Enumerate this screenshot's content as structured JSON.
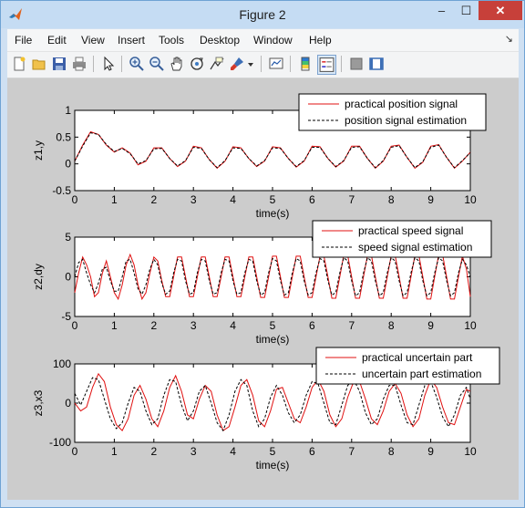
{
  "window": {
    "title": "Figure 2",
    "controls": {
      "minimize": "–",
      "maximize": "☐",
      "close": "✕"
    }
  },
  "menu": [
    "File",
    "Edit",
    "View",
    "Insert",
    "Tools",
    "Desktop",
    "Window",
    "Help"
  ],
  "menu_arrow": "↘",
  "toolbar": {
    "buttons": [
      "new-figure-icon",
      "open-file-icon",
      "save-icon",
      "print-icon",
      "edit-plot-arrow-icon",
      "zoom-in-icon",
      "zoom-out-icon",
      "pan-hand-icon",
      "rotate-3d-icon",
      "data-cursor-icon",
      "brush-icon",
      "brush-dropdown-icon",
      "link-plot-icon",
      "insert-colorbar-icon",
      "insert-legend-icon",
      "hide-plot-tools-icon",
      "show-plot-tools-icon"
    ],
    "active": "insert-legend-icon"
  },
  "colors": {
    "practical": "#e01010",
    "estimate": "#000000",
    "axes_bg": "#ffffff",
    "figure_bg": "#cccccc"
  },
  "chart_data": [
    {
      "type": "line",
      "xlabel": "time(s)",
      "ylabel": "z1,y",
      "xlim": [
        0,
        10
      ],
      "ylim": [
        -0.5,
        1
      ],
      "xticks": [
        "0",
        "1",
        "2",
        "3",
        "4",
        "5",
        "6",
        "7",
        "8",
        "9",
        "10"
      ],
      "yticks": [
        "-0.5",
        "0",
        "0.5",
        "1"
      ],
      "legend": {
        "position": "top-right",
        "entries": [
          "practical position signal",
          "position signal estimation"
        ]
      },
      "series": [
        {
          "name": "practical position signal",
          "style": "solid",
          "x": [
            0,
            0.2,
            0.4,
            0.6,
            0.8,
            1.0,
            1.2,
            1.4,
            1.6,
            1.8,
            2.0,
            2.2,
            2.4,
            2.6,
            2.8,
            3.0,
            3.2,
            3.4,
            3.6,
            3.8,
            4.0,
            4.2,
            4.4,
            4.6,
            4.8,
            5.0,
            5.2,
            5.4,
            5.6,
            5.8,
            6.0,
            6.2,
            6.4,
            6.6,
            6.8,
            7.0,
            7.2,
            7.4,
            7.6,
            7.8,
            8.0,
            8.2,
            8.4,
            8.6,
            8.8,
            9.0,
            9.2,
            9.4,
            9.6,
            9.8,
            10.0
          ],
          "y": [
            0.05,
            0.35,
            0.6,
            0.55,
            0.35,
            0.22,
            0.3,
            0.2,
            -0.02,
            0.05,
            0.3,
            0.3,
            0.1,
            -0.05,
            0.05,
            0.33,
            0.3,
            0.08,
            -0.08,
            0.05,
            0.32,
            0.3,
            0.1,
            -0.05,
            0.05,
            0.32,
            0.3,
            0.1,
            -0.06,
            0.05,
            0.33,
            0.32,
            0.1,
            -0.06,
            0.05,
            0.33,
            0.33,
            0.1,
            -0.08,
            0.05,
            0.33,
            0.35,
            0.12,
            -0.08,
            0.03,
            0.33,
            0.36,
            0.12,
            -0.08,
            0.05,
            0.22
          ]
        },
        {
          "name": "position signal estimation",
          "style": "dashed",
          "x": [
            0,
            0.2,
            0.4,
            0.6,
            0.8,
            1.0,
            1.2,
            1.4,
            1.6,
            1.8,
            2.0,
            2.2,
            2.4,
            2.6,
            2.8,
            3.0,
            3.2,
            3.4,
            3.6,
            3.8,
            4.0,
            4.2,
            4.4,
            4.6,
            4.8,
            5.0,
            5.2,
            5.4,
            5.6,
            5.8,
            6.0,
            6.2,
            6.4,
            6.6,
            6.8,
            7.0,
            7.2,
            7.4,
            7.6,
            7.8,
            8.0,
            8.2,
            8.4,
            8.6,
            8.8,
            9.0,
            9.2,
            9.4,
            9.6,
            9.8,
            10.0
          ],
          "y": [
            0.05,
            0.33,
            0.58,
            0.55,
            0.36,
            0.23,
            0.29,
            0.19,
            0.0,
            0.06,
            0.28,
            0.29,
            0.1,
            -0.04,
            0.06,
            0.31,
            0.29,
            0.08,
            -0.07,
            0.06,
            0.3,
            0.29,
            0.1,
            -0.04,
            0.06,
            0.3,
            0.29,
            0.1,
            -0.05,
            0.06,
            0.31,
            0.31,
            0.1,
            -0.05,
            0.06,
            0.31,
            0.32,
            0.1,
            -0.07,
            0.06,
            0.31,
            0.34,
            0.12,
            -0.07,
            0.04,
            0.31,
            0.35,
            0.12,
            -0.07,
            0.06,
            0.21
          ]
        }
      ]
    },
    {
      "type": "line",
      "xlabel": "time(s)",
      "ylabel": "z2,dy",
      "xlim": [
        0,
        10
      ],
      "ylim": [
        -5,
        5
      ],
      "xticks": [
        "0",
        "1",
        "2",
        "3",
        "4",
        "5",
        "6",
        "7",
        "8",
        "9",
        "10"
      ],
      "yticks": [
        "-5",
        "0",
        "5"
      ],
      "legend": {
        "position": "top-right",
        "entries": [
          "practical speed signal",
          "speed signal estimation"
        ]
      },
      "series": [
        {
          "name": "practical speed signal",
          "style": "solid",
          "x": [
            0,
            0.1,
            0.2,
            0.3,
            0.4,
            0.5,
            0.6,
            0.7,
            0.8,
            0.9,
            1.0,
            1.1,
            1.2,
            1.3,
            1.4,
            1.5,
            1.6,
            1.7,
            1.8,
            1.9,
            2.0,
            2.1,
            2.2,
            2.3,
            2.4,
            2.5,
            2.6,
            2.7,
            2.8,
            2.9,
            3.0,
            3.1,
            3.2,
            3.3,
            3.4,
            3.5,
            3.6,
            3.7,
            3.8,
            3.9,
            4.0,
            4.1,
            4.2,
            4.3,
            4.4,
            4.5,
            4.6,
            4.7,
            4.8,
            4.9,
            5.0,
            5.1,
            5.2,
            5.3,
            5.4,
            5.5,
            5.6,
            5.7,
            5.8,
            5.9,
            6.0,
            6.1,
            6.2,
            6.3,
            6.4,
            6.5,
            6.6,
            6.7,
            6.8,
            6.9,
            7.0,
            7.1,
            7.2,
            7.3,
            7.4,
            7.5,
            7.6,
            7.7,
            7.8,
            7.9,
            8.0,
            8.1,
            8.2,
            8.3,
            8.4,
            8.5,
            8.6,
            8.7,
            8.8,
            8.9,
            9.0,
            9.1,
            9.2,
            9.3,
            9.4,
            9.5,
            9.6,
            9.7,
            9.8,
            9.9,
            10.0
          ],
          "y": [
            -2.0,
            0.5,
            2.5,
            1.5,
            0.0,
            -2.5,
            -2.0,
            0.5,
            2.0,
            0.0,
            -2.0,
            -2.8,
            -1.0,
            1.5,
            2.8,
            1.5,
            -1.0,
            -2.8,
            -2.0,
            0.5,
            2.5,
            2.0,
            -0.5,
            -2.5,
            -2.5,
            0.0,
            2.5,
            2.5,
            0.0,
            -2.5,
            -2.5,
            0.0,
            2.5,
            2.5,
            0.0,
            -2.5,
            -2.5,
            0.0,
            2.5,
            2.5,
            0.0,
            -2.5,
            -2.5,
            0.0,
            2.5,
            2.5,
            0.0,
            -2.6,
            -2.6,
            0.0,
            2.6,
            2.6,
            0.0,
            -2.6,
            -2.6,
            0.0,
            2.6,
            2.6,
            0.0,
            -2.6,
            -2.6,
            0.0,
            2.6,
            2.6,
            0.0,
            -2.7,
            -2.7,
            0.0,
            2.7,
            2.7,
            0.0,
            -2.7,
            -2.7,
            0.0,
            2.7,
            2.7,
            0.0,
            -2.7,
            -2.7,
            0.0,
            2.7,
            2.7,
            0.0,
            -2.7,
            -2.7,
            0.0,
            2.7,
            2.7,
            0.0,
            -2.8,
            -2.8,
            0.0,
            2.8,
            2.8,
            0.0,
            -2.8,
            -2.8,
            0.0,
            2.6,
            1.0,
            -2.5
          ]
        },
        {
          "name": "speed signal estimation",
          "style": "dashed",
          "x": [
            0,
            0.1,
            0.2,
            0.3,
            0.4,
            0.5,
            0.6,
            0.7,
            0.8,
            0.9,
            1.0,
            1.1,
            1.2,
            1.3,
            1.4,
            1.5,
            1.6,
            1.7,
            1.8,
            1.9,
            2.0,
            2.1,
            2.2,
            2.3,
            2.4,
            2.5,
            2.6,
            2.7,
            2.8,
            2.9,
            3.0,
            3.1,
            3.2,
            3.3,
            3.4,
            3.5,
            3.6,
            3.7,
            3.8,
            3.9,
            4.0,
            4.1,
            4.2,
            4.3,
            4.4,
            4.5,
            4.6,
            4.7,
            4.8,
            4.9,
            5.0,
            5.1,
            5.2,
            5.3,
            5.4,
            5.5,
            5.6,
            5.7,
            5.8,
            5.9,
            6.0,
            6.1,
            6.2,
            6.3,
            6.4,
            6.5,
            6.6,
            6.7,
            6.8,
            6.9,
            7.0,
            7.1,
            7.2,
            7.3,
            7.4,
            7.5,
            7.6,
            7.7,
            7.8,
            7.9,
            8.0,
            8.1,
            8.2,
            8.3,
            8.4,
            8.5,
            8.6,
            8.7,
            8.8,
            8.9,
            9.0,
            9.1,
            9.2,
            9.3,
            9.4,
            9.5,
            9.6,
            9.7,
            9.8,
            9.9,
            10.0
          ],
          "y": [
            0.0,
            1.8,
            2.2,
            0.5,
            -1.0,
            -2.0,
            -0.8,
            1.0,
            1.2,
            -0.5,
            -1.8,
            -1.8,
            0.0,
            2.0,
            2.2,
            0.5,
            -1.5,
            -2.2,
            -1.0,
            1.0,
            2.2,
            1.5,
            -0.8,
            -2.2,
            -1.8,
            0.5,
            2.2,
            2.0,
            -0.5,
            -2.2,
            -2.0,
            0.5,
            2.2,
            2.0,
            -0.5,
            -2.2,
            -2.0,
            0.5,
            2.2,
            2.0,
            -0.5,
            -2.2,
            -2.0,
            0.5,
            2.2,
            2.0,
            -0.5,
            -2.3,
            -2.0,
            0.5,
            2.3,
            2.0,
            -0.5,
            -2.3,
            -2.0,
            0.5,
            2.3,
            2.0,
            -0.5,
            -2.3,
            -2.0,
            0.5,
            2.3,
            2.0,
            -0.5,
            -2.3,
            -2.0,
            0.5,
            2.4,
            2.0,
            -0.5,
            -2.4,
            -2.0,
            0.5,
            2.4,
            2.0,
            -0.5,
            -2.4,
            -2.0,
            0.5,
            2.4,
            2.0,
            -0.5,
            -2.4,
            -2.0,
            0.5,
            2.4,
            2.0,
            -0.5,
            -2.4,
            -2.0,
            0.5,
            2.4,
            2.0,
            -0.5,
            -2.4,
            -2.0,
            0.5,
            2.2,
            1.5,
            0.0
          ]
        }
      ]
    },
    {
      "type": "line",
      "xlabel": "time(s)",
      "ylabel": "z3,x3",
      "xlim": [
        0,
        10
      ],
      "ylim": [
        -100,
        100
      ],
      "xticks": [
        "0",
        "1",
        "2",
        "3",
        "4",
        "5",
        "6",
        "7",
        "8",
        "9",
        "10"
      ],
      "yticks": [
        "-100",
        "0",
        "100"
      ],
      "legend": {
        "position": "top-right",
        "entries": [
          "practical uncertain part",
          "uncertain part estimation"
        ]
      },
      "series": [
        {
          "name": "practical uncertain part",
          "style": "solid",
          "x": [
            0,
            0.15,
            0.3,
            0.45,
            0.6,
            0.75,
            0.9,
            1.05,
            1.2,
            1.35,
            1.5,
            1.65,
            1.8,
            1.95,
            2.1,
            2.25,
            2.4,
            2.55,
            2.7,
            2.85,
            3.0,
            3.15,
            3.3,
            3.45,
            3.6,
            3.75,
            3.9,
            4.05,
            4.2,
            4.35,
            4.5,
            4.65,
            4.8,
            4.95,
            5.1,
            5.25,
            5.4,
            5.55,
            5.7,
            5.85,
            6.0,
            6.15,
            6.3,
            6.45,
            6.6,
            6.75,
            6.9,
            7.05,
            7.2,
            7.35,
            7.5,
            7.65,
            7.8,
            7.95,
            8.1,
            8.25,
            8.4,
            8.55,
            8.7,
            8.85,
            9.0,
            9.15,
            9.3,
            9.45,
            9.6,
            9.75,
            9.9,
            10.0
          ],
          "y": [
            0,
            -20,
            -10,
            40,
            75,
            55,
            -10,
            -55,
            -70,
            -40,
            20,
            45,
            10,
            -40,
            -60,
            -20,
            40,
            70,
            30,
            -30,
            -40,
            10,
            45,
            30,
            -30,
            -70,
            -60,
            -10,
            45,
            60,
            20,
            -45,
            -60,
            -20,
            35,
            40,
            0,
            -40,
            -50,
            -10,
            40,
            60,
            30,
            -30,
            -60,
            -40,
            15,
            55,
            55,
            10,
            -40,
            -55,
            -20,
            30,
            50,
            25,
            -30,
            -60,
            -40,
            20,
            60,
            40,
            -10,
            -50,
            -55,
            -10,
            35,
            30
          ]
        },
        {
          "name": "uncertain part estimation",
          "style": "dashed",
          "x": [
            0,
            0.15,
            0.3,
            0.45,
            0.6,
            0.75,
            0.9,
            1.05,
            1.2,
            1.35,
            1.5,
            1.65,
            1.8,
            1.95,
            2.1,
            2.25,
            2.4,
            2.55,
            2.7,
            2.85,
            3.0,
            3.15,
            3.3,
            3.45,
            3.6,
            3.75,
            3.9,
            4.05,
            4.2,
            4.35,
            4.5,
            4.65,
            4.8,
            4.95,
            5.1,
            5.25,
            5.4,
            5.55,
            5.7,
            5.85,
            6.0,
            6.15,
            6.3,
            6.45,
            6.6,
            6.75,
            6.9,
            7.05,
            7.2,
            7.35,
            7.5,
            7.65,
            7.8,
            7.95,
            8.1,
            8.25,
            8.4,
            8.55,
            8.7,
            8.85,
            9.0,
            9.15,
            9.3,
            9.45,
            9.6,
            9.75,
            9.9,
            10.0
          ],
          "y": [
            25,
            -5,
            30,
            65,
            60,
            10,
            -40,
            -65,
            -50,
            0,
            40,
            30,
            -20,
            -55,
            -40,
            20,
            60,
            55,
            -5,
            -45,
            -20,
            30,
            45,
            0,
            -50,
            -70,
            -30,
            30,
            60,
            45,
            -20,
            -60,
            -40,
            15,
            45,
            20,
            -25,
            -50,
            -30,
            20,
            55,
            50,
            0,
            -50,
            -55,
            -5,
            45,
            60,
            30,
            -25,
            -55,
            -40,
            10,
            45,
            45,
            -5,
            -50,
            -55,
            -5,
            45,
            55,
            15,
            -35,
            -60,
            -30,
            20,
            40,
            10
          ]
        }
      ]
    }
  ]
}
